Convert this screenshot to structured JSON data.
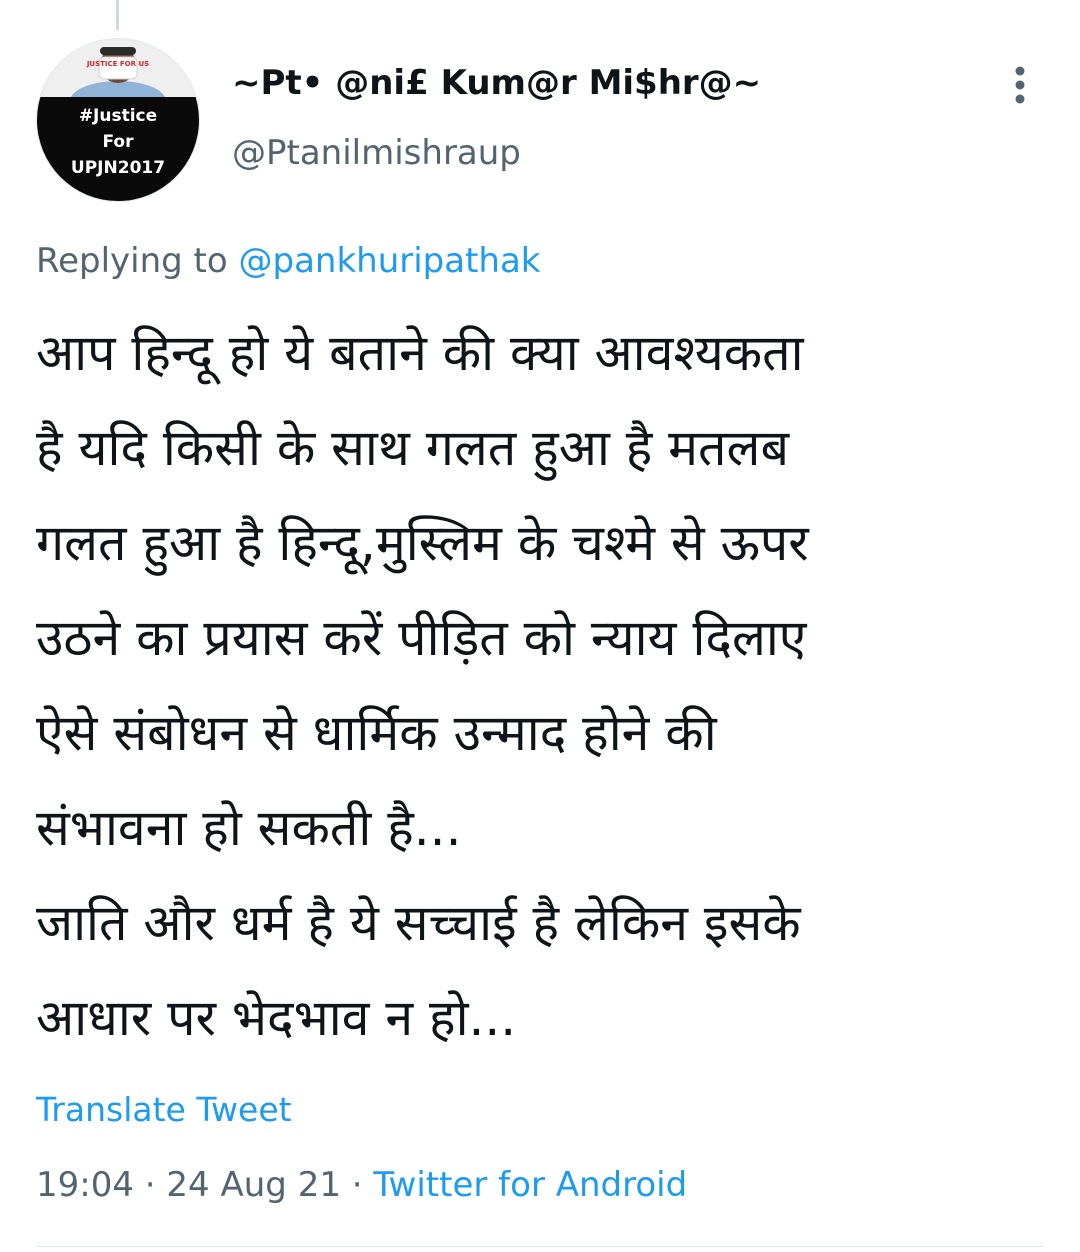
{
  "avatar": {
    "badge_text": "JUSTICE FOR US",
    "lines": [
      "#Justice",
      "For",
      "UPJN2017"
    ]
  },
  "author": {
    "display_name": "~Pt• @ni£ Kum@r Mi$hr@~",
    "handle": "@Ptanilmishraup"
  },
  "reply": {
    "prefix": "Replying to ",
    "mention": "@pankhuripathak"
  },
  "tweet": {
    "lines": [
      "आप हिन्दू हो ये बताने की क्या आवश्यकता",
      "है यदि किसी के साथ गलत हुआ है मतलब",
      "गलत हुआ है हिन्दू,मुस्लिम के चश्मे से ऊपर",
      "उठने का प्रयास करें पीड़ित को न्याय दिलाए",
      "ऐसे संबोधन से धार्मिक उन्माद होने की",
      "संभावना हो सकती है...",
      "जाति और धर्म है ये सच्चाई है लेकिन इसके",
      "आधार पर भेदभाव न हो..."
    ]
  },
  "translate_label": "Translate Tweet",
  "meta": {
    "time": "19:04",
    "separator": " · ",
    "date": "24 Aug 21",
    "source": "Twitter for Android"
  },
  "colors": {
    "text": "#0f1419",
    "secondary": "#536471",
    "link": "#1d9bf0"
  },
  "icons": {
    "more": "more-vertical-icon"
  }
}
